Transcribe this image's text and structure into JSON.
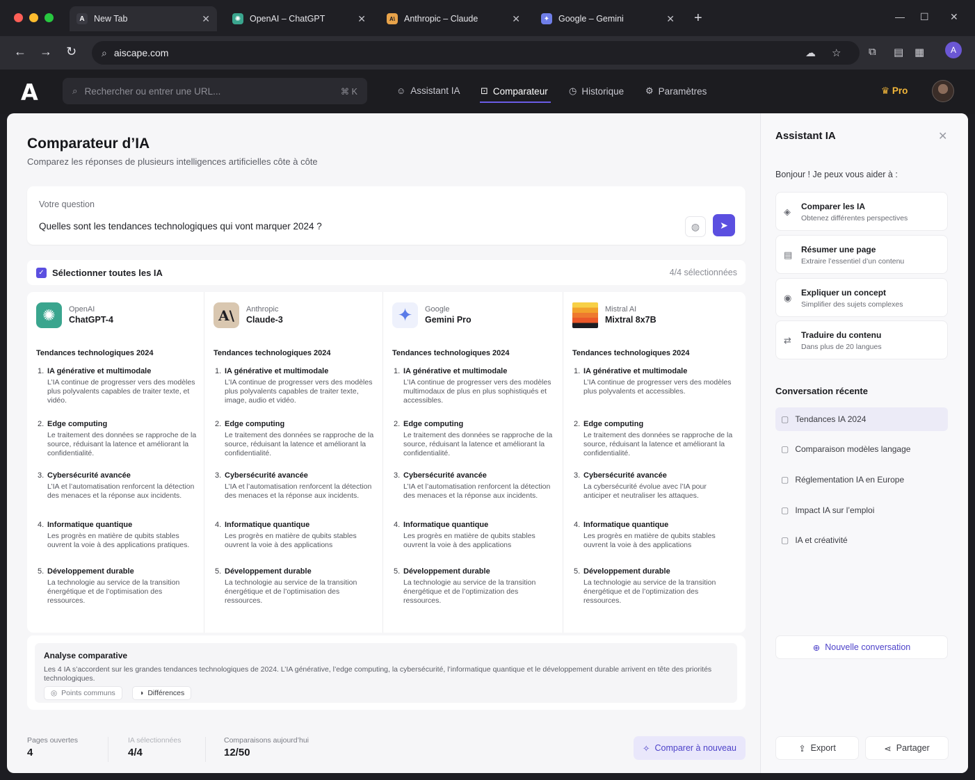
{
  "browser": {
    "tabs": [
      {
        "label": "New Tab",
        "icon": "A"
      },
      {
        "label": "OpenAI – ChatGPT",
        "icon": "✺"
      },
      {
        "label": "Anthropic – Claude",
        "icon": "A\\"
      },
      {
        "label": "Google – Gemini",
        "icon": "✦"
      }
    ],
    "address": "aiscape.com",
    "profile_initial": "A"
  },
  "app": {
    "logo": "A",
    "search_placeholder": "Rechercher ou entrer une URL...",
    "search_shortcut": "⌘ K",
    "nav": [
      {
        "label": "Assistant IA",
        "icon": "robot-icon"
      },
      {
        "label": "Comparateur",
        "icon": "compare-icon"
      },
      {
        "label": "Historique",
        "icon": "clock-icon"
      },
      {
        "label": "Paramètres",
        "icon": "gear-icon"
      }
    ],
    "pro_label": "Pro"
  },
  "main": {
    "title": "Comparateur d’IA",
    "subtitle": "Comparez les réponses de plusieurs intelligences artificielles côte à côte",
    "question_label": "Votre question",
    "question_value": "Quelles sont les tendances technologiques qui vont marquer 2024 ?",
    "select_all_label": "Sélectionner toutes les IA",
    "selected_count": "4/4 sélectionnées",
    "models": [
      {
        "provider": "OpenAI",
        "name": "ChatGPT-4",
        "logo_color": "#3aa58e",
        "section": "Tendances technologiques 2024",
        "items": [
          {
            "n": "1.",
            "title": "IA générative et multimodale",
            "desc": "L’IA continue de progresser vers des modèles plus polyvalents capables de traiter texte, et vidéo."
          },
          {
            "n": "2.",
            "title": "Edge computing",
            "desc": "Le traitement des données se rapproche de la source, réduisant la latence et améliorant la confidentialité."
          },
          {
            "n": "3.",
            "title": "Cybersécurité avancée",
            "desc": "L’IA et l’automatisation renforcent la détection des menaces et la réponse aux incidents."
          },
          {
            "n": "4.",
            "title": "Informatique quantique",
            "desc": "Les progrès en matière de qubits stables ouvrent la voie à des applications pratiques."
          },
          {
            "n": "5.",
            "title": "Développement durable",
            "desc": "La technologie au service de la transition énergétique et de l’optimisation des ressources."
          }
        ]
      },
      {
        "provider": "Anthropic",
        "name": "Claude-3",
        "logo_color": "#d9c7b0",
        "section": "Tendances technologiques 2024",
        "items": [
          {
            "n": "1.",
            "title": "IA générative et multimodale",
            "desc": "L’IA continue de progresser vers des modèles plus polyvalents capables de traiter texte, image, audio et vidéo."
          },
          {
            "n": "2.",
            "title": "Edge computing",
            "desc": "Le traitement des données se rapproche de la source, réduisant la latence et améliorant la confidentialité."
          },
          {
            "n": "3.",
            "title": "Cybersécurité avancée",
            "desc": "L’IA et l’automatisation renforcent la détection des menaces et la réponse aux incidents."
          },
          {
            "n": "4.",
            "title": "Informatique quantique",
            "desc": "Les progrès en matière de qubits stables ouvrent la voie à des applications"
          },
          {
            "n": "5.",
            "title": "Développement durable",
            "desc": "La technologie au service de la transition énergétique et de l’optimisation des ressources."
          }
        ]
      },
      {
        "provider": "Google",
        "name": "Gemini Pro",
        "logo_color": "#e8edfb",
        "section": "Tendances technologiques 2024",
        "items": [
          {
            "n": "1.",
            "title": "IA générative et multimodale",
            "desc": "L’IA continue de progresser vers des modèles multimodaux de plus en plus sophistiqués et accessibles."
          },
          {
            "n": "2.",
            "title": "Edge computing",
            "desc": "Le traitement des données se rapproche de la source, réduisant la latence et améliorant la confidentialité."
          },
          {
            "n": "3.",
            "title": "Cybersécurité avancée",
            "desc": "L’IA et l’automatisation renforcent la détection des menaces et la réponse aux incidents."
          },
          {
            "n": "4.",
            "title": "Informatique quantique",
            "desc": "Les progrès en matière de qubits stables ouvrent la voie à des applications"
          },
          {
            "n": "5.",
            "title": "Développement durable",
            "desc": "La technologie au service de la transition énergétique et de l’optimization des ressources."
          }
        ]
      },
      {
        "provider": "Mistral AI",
        "name": "Mixtral 8x7B",
        "logo_color": "#f2a12c",
        "section": "Tendances technologiques 2024",
        "items": [
          {
            "n": "1.",
            "title": "IA générative et multimodale",
            "desc": "L’IA continue de progresser vers des modèles plus polyvalents et accessibles."
          },
          {
            "n": "2.",
            "title": "Edge computing",
            "desc": "Le traitement des données se rapproche de la source, réduisant la latence et améliorant la confidentialité."
          },
          {
            "n": "3.",
            "title": "Cybersécurité avancée",
            "desc": "La cybersécurité évolue avec l’IA pour anticiper et neutraliser les attaques."
          },
          {
            "n": "4.",
            "title": "Informatique quantique",
            "desc": "Les progrès en matière de qubits stables ouvrent la voie à des applications"
          },
          {
            "n": "5.",
            "title": "Développement durable",
            "desc": "La technologie au service de la transition énergétique et de l’optimization des ressources."
          }
        ]
      }
    ],
    "analysis": {
      "title": "Analyse comparative",
      "text": "Les 4 IA s’accordent sur les grandes tendances technologiques de 2024. L’IA générative, l’edge computing, la cybersécurité, l’informatique quantique et le développement durable arrivent en tête des priorités technologiques.",
      "chips": [
        "Points communs",
        "Différences"
      ]
    },
    "footer": {
      "stats": [
        {
          "label": "Pages ouvertes",
          "value": "4"
        },
        {
          "label": "IA sélectionnées",
          "value": "4/4"
        },
        {
          "label": "Comparaisons aujourd’hui",
          "value": "12/50"
        }
      ],
      "recompare_label": "Comparer à nouveau"
    }
  },
  "sidebar": {
    "title": "Assistant IA",
    "greeting": "Bonjour ! Je peux vous aider à :",
    "actions": [
      {
        "title": "Comparer les IA",
        "sub": "Obtenez différentes perspectives"
      },
      {
        "title": "Résumer une page",
        "sub": "Extraire l’essentiel d’un contenu"
      },
      {
        "title": "Expliquer un concept",
        "sub": "Simplifier des sujets complexes"
      },
      {
        "title": "Traduire du contenu",
        "sub": "Dans plus de 20 langues"
      }
    ],
    "recent_title": "Conversation récente",
    "conversations": [
      "Tendances IA 2024",
      "Comparaison modèles langage",
      "Réglementation IA en Europe",
      "Impact IA sur l’emploi",
      "IA et créativité"
    ],
    "new_conversation": "Nouvelle conversation",
    "export_label": "Export",
    "share_label": "Partager"
  }
}
